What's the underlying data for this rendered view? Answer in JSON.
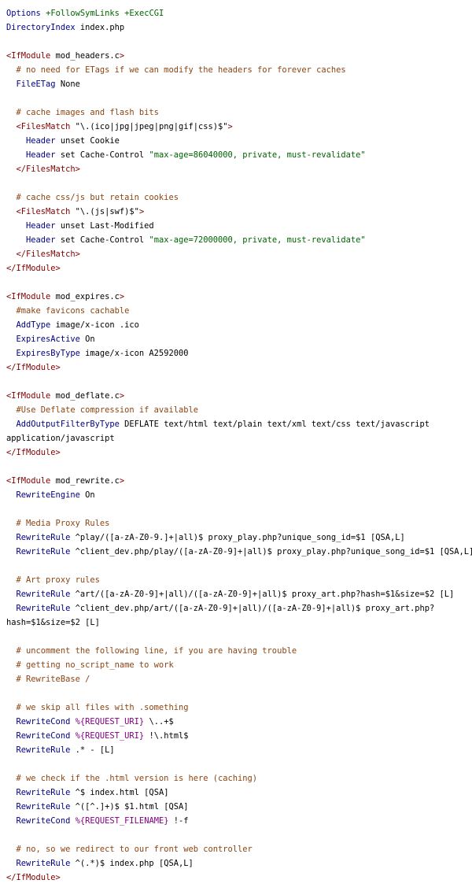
{
  "colors": {
    "background": "#ffffff",
    "keyword": "#000080",
    "tag": "#800000",
    "comment": "#8b4513",
    "string": "#006400",
    "variable": "#800080"
  },
  "lines": [
    [
      [
        "opt",
        "Options"
      ],
      [
        "txt",
        " "
      ],
      [
        "str",
        "+FollowSymLinks"
      ],
      [
        "txt",
        " "
      ],
      [
        "str",
        "+ExecCGI"
      ]
    ],
    [
      [
        "kw",
        "DirectoryIndex"
      ],
      [
        "txt",
        " index.php"
      ]
    ],
    [],
    [
      [
        "tag",
        "<IfModule"
      ],
      [
        "txt",
        " mod_headers.c"
      ],
      [
        "tag",
        ">"
      ]
    ],
    [
      [
        "txt",
        "  "
      ],
      [
        "cm",
        "# no need for ETags if we can modify the headers for forever caches"
      ]
    ],
    [
      [
        "txt",
        "  "
      ],
      [
        "kw",
        "FileETag"
      ],
      [
        "txt",
        " None"
      ]
    ],
    [],
    [
      [
        "txt",
        "  "
      ],
      [
        "cm",
        "# cache images and flash bits"
      ]
    ],
    [
      [
        "txt",
        "  "
      ],
      [
        "tag",
        "<FilesMatch"
      ],
      [
        "txt",
        " \"\\.(ico|jpg|jpeg|png|gif|css)$\""
      ],
      [
        "tag",
        ">"
      ]
    ],
    [
      [
        "txt",
        "    "
      ],
      [
        "kw",
        "Header"
      ],
      [
        "txt",
        " unset Cookie"
      ]
    ],
    [
      [
        "txt",
        "    "
      ],
      [
        "kw",
        "Header"
      ],
      [
        "txt",
        " set Cache-Control "
      ],
      [
        "str",
        "\"max-age=86040000, private, must-revalidate\""
      ]
    ],
    [
      [
        "txt",
        "  "
      ],
      [
        "tag",
        "</FilesMatch>"
      ]
    ],
    [],
    [
      [
        "txt",
        "  "
      ],
      [
        "cm",
        "# cache css/js but retain cookies"
      ]
    ],
    [
      [
        "txt",
        "  "
      ],
      [
        "tag",
        "<FilesMatch"
      ],
      [
        "txt",
        " \"\\.(js|swf)$\""
      ],
      [
        "tag",
        ">"
      ]
    ],
    [
      [
        "txt",
        "    "
      ],
      [
        "kw",
        "Header"
      ],
      [
        "txt",
        " unset Last-Modified"
      ]
    ],
    [
      [
        "txt",
        "    "
      ],
      [
        "kw",
        "Header"
      ],
      [
        "txt",
        " set Cache-Control "
      ],
      [
        "str",
        "\"max-age=72000000, private, must-revalidate\""
      ]
    ],
    [
      [
        "txt",
        "  "
      ],
      [
        "tag",
        "</FilesMatch>"
      ]
    ],
    [
      [
        "tag",
        "</IfModule>"
      ]
    ],
    [],
    [
      [
        "tag",
        "<IfModule"
      ],
      [
        "txt",
        " mod_expires.c"
      ],
      [
        "tag",
        ">"
      ]
    ],
    [
      [
        "txt",
        "  "
      ],
      [
        "cm",
        "#make favicons cachable"
      ]
    ],
    [
      [
        "txt",
        "  "
      ],
      [
        "kw",
        "AddType"
      ],
      [
        "txt",
        " image/x-icon .ico"
      ]
    ],
    [
      [
        "txt",
        "  "
      ],
      [
        "kw",
        "ExpiresActive"
      ],
      [
        "txt",
        " On"
      ]
    ],
    [
      [
        "txt",
        "  "
      ],
      [
        "kw",
        "ExpiresByType"
      ],
      [
        "txt",
        " image/x-icon A2592000"
      ]
    ],
    [
      [
        "tag",
        "</IfModule>"
      ]
    ],
    [],
    [
      [
        "tag",
        "<IfModule"
      ],
      [
        "txt",
        " mod_deflate.c"
      ],
      [
        "tag",
        ">"
      ]
    ],
    [
      [
        "txt",
        "  "
      ],
      [
        "cm",
        "#Use Deflate compression if available"
      ]
    ],
    [
      [
        "txt",
        "  "
      ],
      [
        "kw",
        "AddOutputFilterByType"
      ],
      [
        "txt",
        " DEFLATE text/html text/plain text/xml text/css text/javascript"
      ]
    ],
    [
      [
        "txt",
        "application/javascript"
      ]
    ],
    [
      [
        "tag",
        "</IfModule>"
      ]
    ],
    [],
    [
      [
        "tag",
        "<IfModule"
      ],
      [
        "txt",
        " mod_rewrite.c"
      ],
      [
        "tag",
        ">"
      ]
    ],
    [
      [
        "txt",
        "  "
      ],
      [
        "kw",
        "RewriteEngine"
      ],
      [
        "txt",
        " On"
      ]
    ],
    [],
    [
      [
        "txt",
        "  "
      ],
      [
        "cm",
        "# Media Proxy Rules"
      ]
    ],
    [
      [
        "txt",
        "  "
      ],
      [
        "kw",
        "RewriteRule"
      ],
      [
        "txt",
        " ^play/([a-zA-Z0-9.]+|all)$ proxy_play.php?unique_song_id=$1 [QSA,L]"
      ]
    ],
    [
      [
        "txt",
        "  "
      ],
      [
        "kw",
        "RewriteRule"
      ],
      [
        "txt",
        " ^client_dev.php/play/([a-zA-Z0-9]+|all)$ proxy_play.php?unique_song_id=$1 [QSA,L]"
      ]
    ],
    [],
    [
      [
        "txt",
        "  "
      ],
      [
        "cm",
        "# Art proxy rules"
      ]
    ],
    [
      [
        "txt",
        "  "
      ],
      [
        "kw",
        "RewriteRule"
      ],
      [
        "txt",
        " ^art/([a-zA-Z0-9]+|all)/([a-zA-Z0-9]+|all)$ proxy_art.php?hash=$1&size=$2 [L]"
      ]
    ],
    [
      [
        "txt",
        "  "
      ],
      [
        "kw",
        "RewriteRule"
      ],
      [
        "txt",
        " ^client_dev.php/art/([a-zA-Z0-9]+|all)/([a-zA-Z0-9]+|all)$ proxy_art.php?"
      ]
    ],
    [
      [
        "txt",
        "hash=$1&size=$2 [L]"
      ]
    ],
    [],
    [
      [
        "txt",
        "  "
      ],
      [
        "cm",
        "# uncomment the following line, if you are having trouble"
      ]
    ],
    [
      [
        "txt",
        "  "
      ],
      [
        "cm",
        "# getting no_script_name to work"
      ]
    ],
    [
      [
        "txt",
        "  "
      ],
      [
        "cm",
        "# RewriteBase /"
      ]
    ],
    [],
    [
      [
        "txt",
        "  "
      ],
      [
        "cm",
        "# we skip all files with .something"
      ]
    ],
    [
      [
        "txt",
        "  "
      ],
      [
        "kw",
        "RewriteCond"
      ],
      [
        "txt",
        " "
      ],
      [
        "var",
        "%{REQUEST_URI}"
      ],
      [
        "txt",
        " \\..+$"
      ]
    ],
    [
      [
        "txt",
        "  "
      ],
      [
        "kw",
        "RewriteCond"
      ],
      [
        "txt",
        " "
      ],
      [
        "var",
        "%{REQUEST_URI}"
      ],
      [
        "txt",
        " !\\.html$"
      ]
    ],
    [
      [
        "txt",
        "  "
      ],
      [
        "kw",
        "RewriteRule"
      ],
      [
        "txt",
        " .* - [L]"
      ]
    ],
    [],
    [
      [
        "txt",
        "  "
      ],
      [
        "cm",
        "# we check if the .html version is here (caching)"
      ]
    ],
    [
      [
        "txt",
        "  "
      ],
      [
        "kw",
        "RewriteRule"
      ],
      [
        "txt",
        " ^$ index.html [QSA]"
      ]
    ],
    [
      [
        "txt",
        "  "
      ],
      [
        "kw",
        "RewriteRule"
      ],
      [
        "txt",
        " ^([^.]+)$ $1.html [QSA]"
      ]
    ],
    [
      [
        "txt",
        "  "
      ],
      [
        "kw",
        "RewriteCond"
      ],
      [
        "txt",
        " "
      ],
      [
        "var",
        "%{REQUEST_FILENAME}"
      ],
      [
        "txt",
        " !-f"
      ]
    ],
    [],
    [
      [
        "txt",
        "  "
      ],
      [
        "cm",
        "# no, so we redirect to our front web controller"
      ]
    ],
    [
      [
        "txt",
        "  "
      ],
      [
        "kw",
        "RewriteRule"
      ],
      [
        "txt",
        " ^(.*)$ index.php [QSA,L]"
      ]
    ],
    [
      [
        "tag",
        "</IfModule>"
      ]
    ]
  ]
}
